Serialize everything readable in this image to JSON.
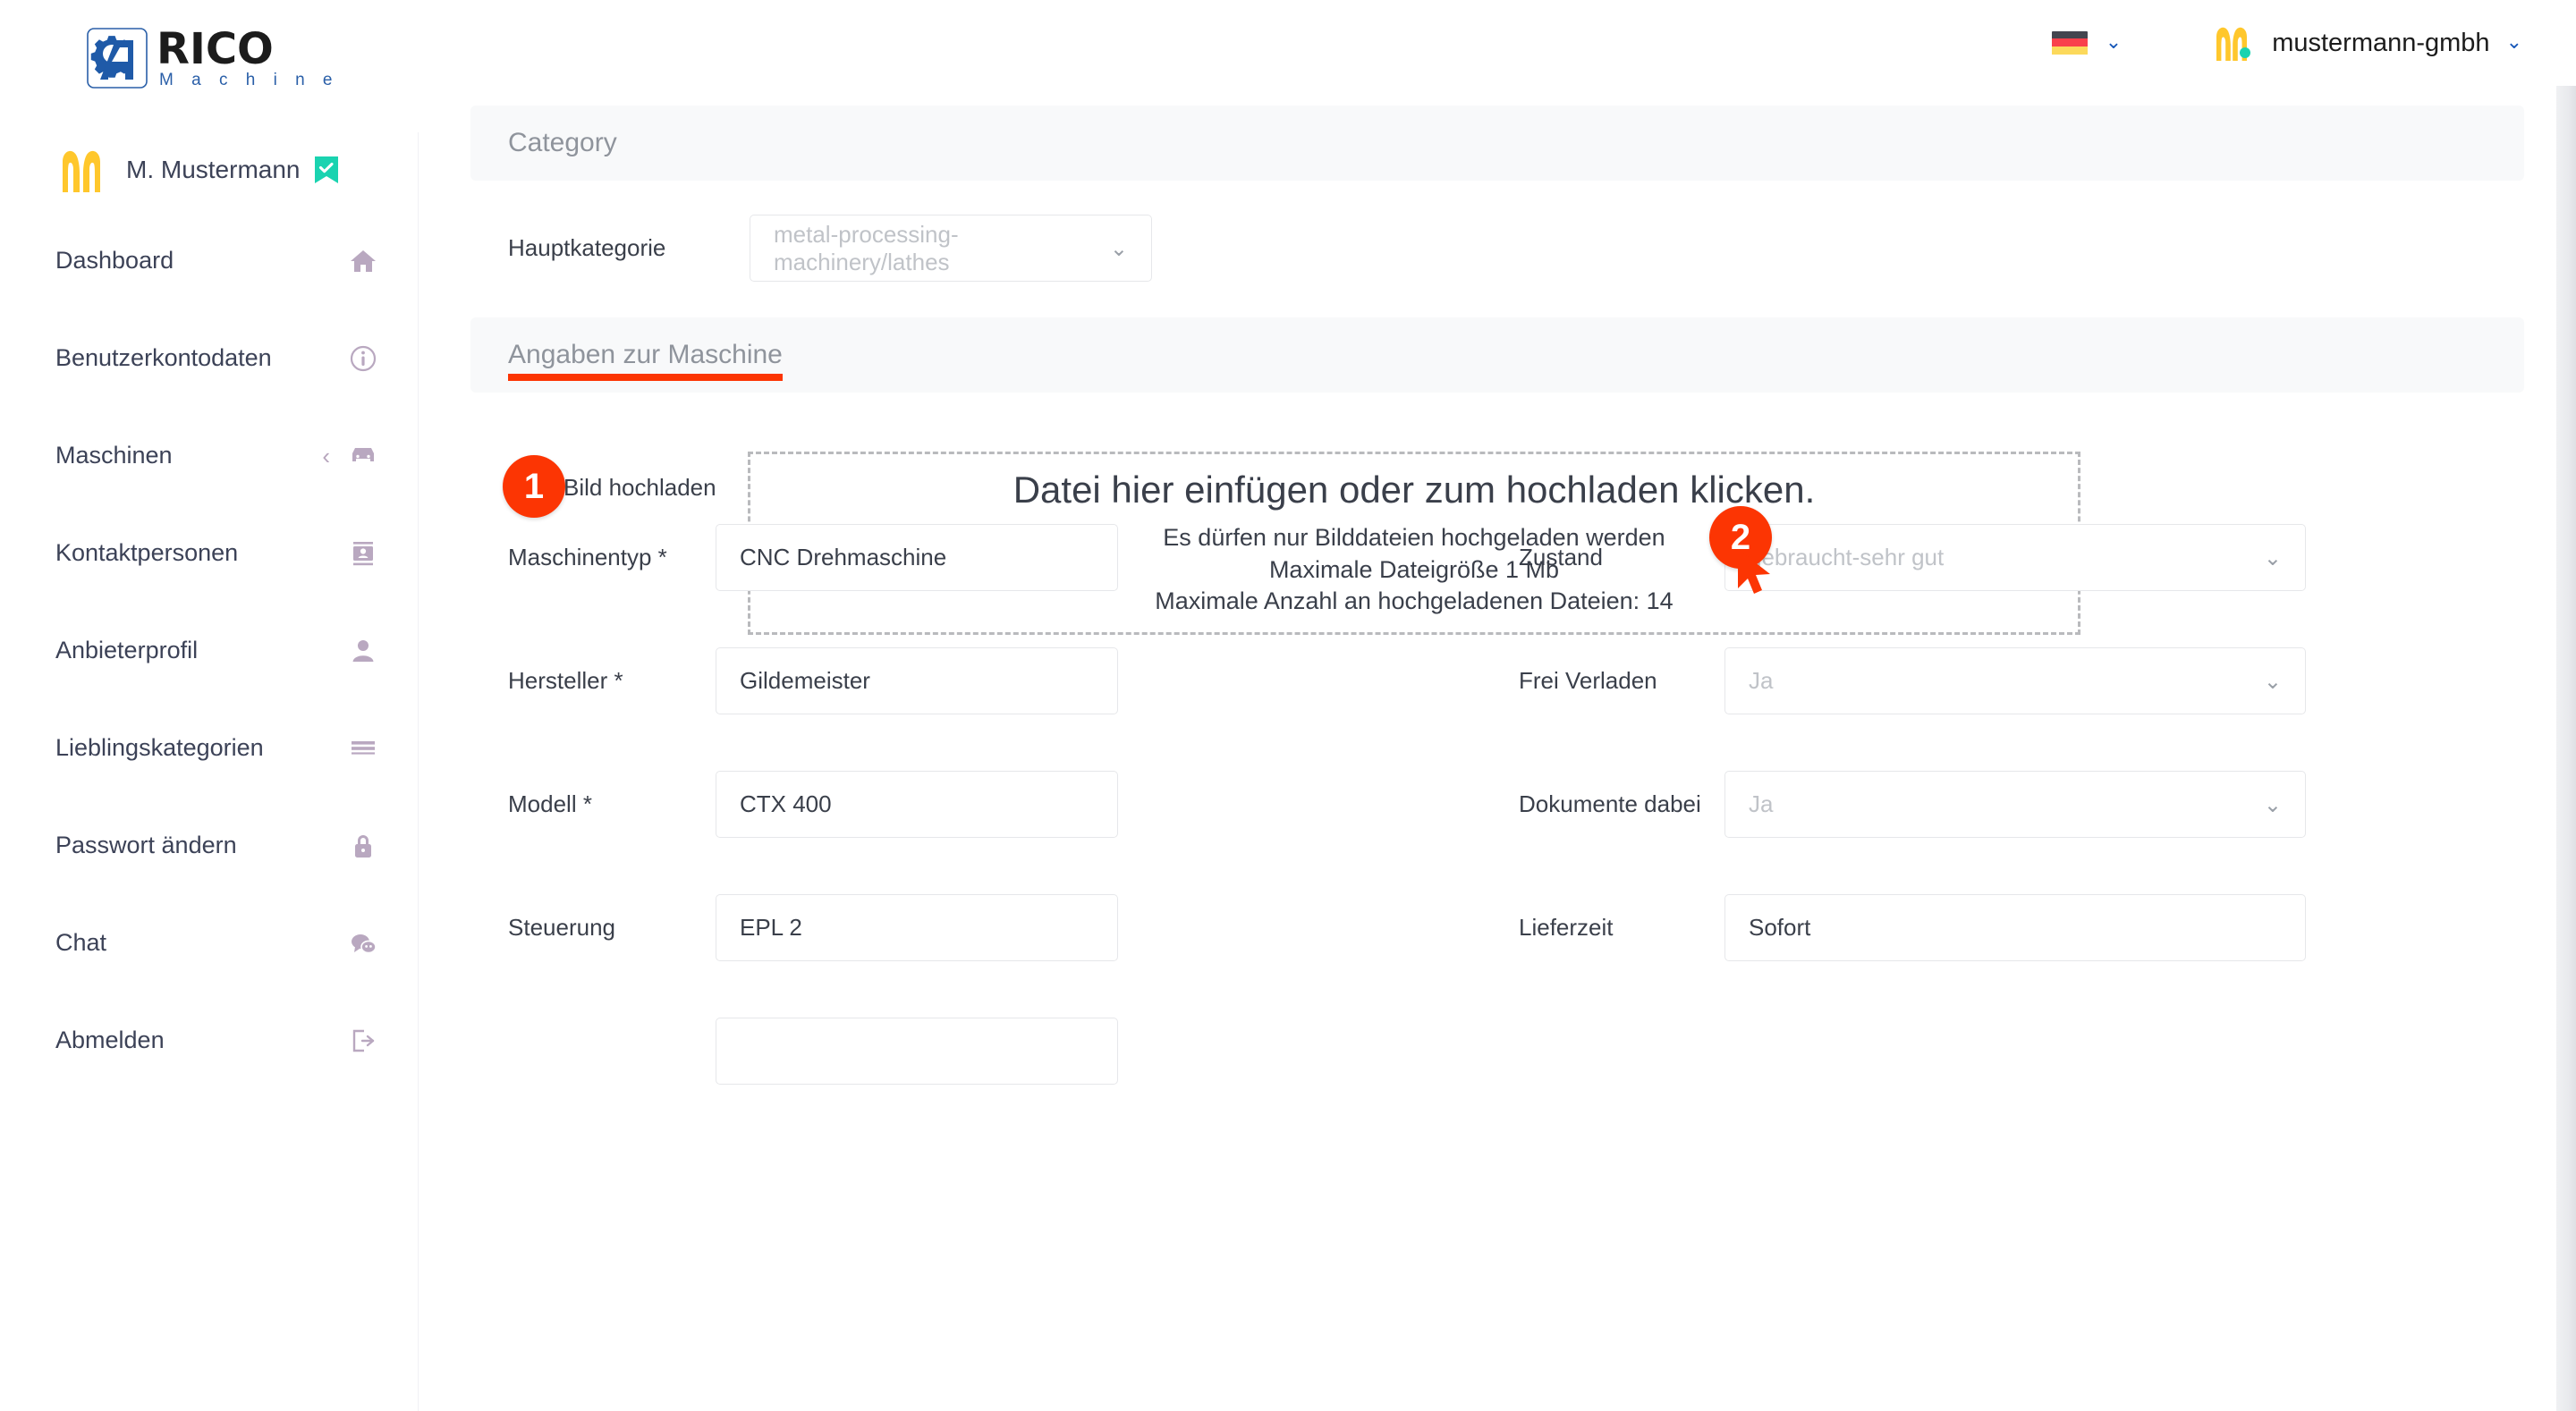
{
  "brand": {
    "name_main": "RICO",
    "name_sub": "M a c h i n e",
    "logo_blue": "#2a5fa8",
    "accent_red": "#fc3503"
  },
  "sidebar": {
    "user": {
      "name": "M. Mustermann",
      "verified_icon": "verified-check-icon"
    },
    "items": [
      {
        "label": "Dashboard",
        "icon": "home-icon",
        "has_chevron": false
      },
      {
        "label": "Benutzerkontodaten",
        "icon": "info-icon",
        "has_chevron": false
      },
      {
        "label": "Maschinen",
        "icon": "machine-icon",
        "has_chevron": true,
        "chevron": "‹"
      },
      {
        "label": "Kontaktpersonen",
        "icon": "contacts-icon",
        "has_chevron": false
      },
      {
        "label": "Anbieterprofil",
        "icon": "person-icon",
        "has_chevron": false
      },
      {
        "label": "Lieblingskategorien",
        "icon": "list-icon",
        "has_chevron": false
      },
      {
        "label": "Passwort ändern",
        "icon": "lock-icon",
        "has_chevron": false
      },
      {
        "label": "Chat",
        "icon": "chat-icon",
        "has_chevron": false
      },
      {
        "label": "Abmelden",
        "icon": "logout-icon",
        "has_chevron": false
      }
    ]
  },
  "topbar": {
    "language": {
      "flag": "german-flag-icon",
      "caret": "⌄"
    },
    "account": {
      "name": "mustermann-gmbh",
      "caret": "⌄",
      "avatar": "m-logo-avatar"
    }
  },
  "main": {
    "category_section": {
      "title": "Category",
      "hauptkategorie": {
        "label": "Hauptkategorie",
        "value": "metal-processing-machinery/lathes",
        "caret": "⌄"
      }
    },
    "machine_section": {
      "title": "Angaben zur Maschine",
      "underline_color": "#fc3503"
    },
    "upload": {
      "badge": "1",
      "label": "Bild hochladen",
      "dropzone_title": "Datei hier einfügen oder zum hochladen klicken.",
      "dropzone_line1": "Es dürfen nur Bilddateien hochgeladen werden",
      "dropzone_line2": "Maximale Dateigröße 1 Mb",
      "dropzone_line3": "Maximale Anzahl an hochgeladenen Dateien: 14",
      "badge2": "2",
      "cursor": "mouse-pointer-icon"
    },
    "fields_left": [
      {
        "label": "Maschinentyp *",
        "value": "CNC Drehmaschine",
        "type": "text"
      },
      {
        "label": "Hersteller *",
        "value": "Gildemeister",
        "type": "text"
      },
      {
        "label": "Modell *",
        "value": "CTX 400",
        "type": "text"
      },
      {
        "label": "Steuerung",
        "value": "EPL 2",
        "type": "text"
      }
    ],
    "fields_right": [
      {
        "label": "Zustand",
        "value": "gebraucht-sehr gut",
        "type": "select",
        "placeholder": true,
        "caret": "⌄"
      },
      {
        "label": "Frei Verladen",
        "value": "Ja",
        "type": "select",
        "placeholder": true,
        "caret": "⌄"
      },
      {
        "label": "Dokumente dabei",
        "value": "Ja",
        "type": "select",
        "placeholder": true,
        "caret": "⌄"
      },
      {
        "label": "Lieferzeit",
        "value": "Sofort",
        "type": "text",
        "placeholder": false
      }
    ]
  }
}
